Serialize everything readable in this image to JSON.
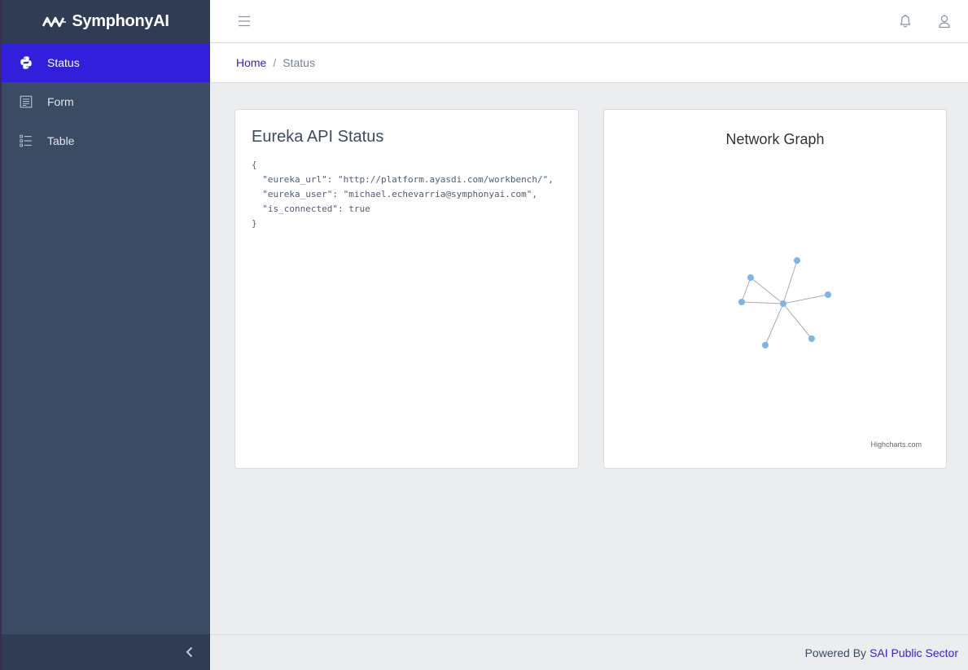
{
  "brand": {
    "name": "SymphonyAI",
    "logo_icon": "symphony-wave-icon"
  },
  "sidebar": {
    "items": [
      {
        "label": "Status",
        "icon": "python-icon",
        "active": true
      },
      {
        "label": "Form",
        "icon": "form-icon",
        "active": false
      },
      {
        "label": "Table",
        "icon": "list-icon",
        "active": false
      }
    ],
    "collapse_icon": "chevron-left-icon"
  },
  "header": {
    "toggler_icon": "hamburger-icon",
    "right_icons": [
      "bell-icon",
      "user-icon"
    ]
  },
  "breadcrumb": {
    "home": "Home",
    "separator": "/",
    "current": "Status"
  },
  "status_card": {
    "title": "Eureka API Status",
    "json_text": "{\n  \"eureka_url\": \"http://platform.ayasdi.com/workbench/\",\n  \"eureka_user\": \"michael.echevarria@symphonyai.com\",\n  \"is_connected\": true\n}"
  },
  "graph_card": {
    "credits": "Highcharts.com"
  },
  "chart_data": {
    "type": "network",
    "title": "Network Graph",
    "node_color": "#7cb5ec",
    "link_color": "#aaaaaa",
    "nodes": [
      "n0",
      "n1",
      "n2",
      "n3",
      "n4",
      "n5",
      "n6"
    ],
    "links": [
      [
        "n0",
        "n1"
      ],
      [
        "n0",
        "n2"
      ],
      [
        "n0",
        "n3"
      ],
      [
        "n0",
        "n4"
      ],
      [
        "n0",
        "n5"
      ],
      [
        "n0",
        "n6"
      ],
      [
        "n2",
        "n3"
      ]
    ]
  },
  "footer": {
    "prefix": "Powered By",
    "link": "SAI Public Sector"
  },
  "colors": {
    "accent": "#321fdb",
    "sidebar_bg": "#3c4b64",
    "sidebar_dark": "#303c54"
  }
}
